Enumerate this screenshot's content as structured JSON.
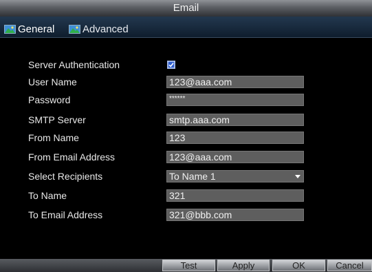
{
  "window": {
    "title": "Email"
  },
  "tabs": [
    {
      "label": "General",
      "active": true
    },
    {
      "label": "Advanced",
      "active": false
    }
  ],
  "form": {
    "server_authentication": {
      "label": "Server Authentication",
      "checked": true
    },
    "user_name": {
      "label": "User Name",
      "value": "123@aaa.com"
    },
    "password": {
      "label": "Password",
      "value": "******"
    },
    "smtp_server": {
      "label": "SMTP Server",
      "value": "smtp.aaa.com"
    },
    "from_name": {
      "label": "From Name",
      "value": "123"
    },
    "from_email_address": {
      "label": "From Email Address",
      "value": "123@aaa.com"
    },
    "select_recipients": {
      "label": "Select Recipients",
      "value": "To Name 1"
    },
    "to_name": {
      "label": "To Name",
      "value": "321"
    },
    "to_email_address": {
      "label": "To Email Address",
      "value": "321@bbb.com"
    }
  },
  "buttons": {
    "test": "Test",
    "apply": "Apply",
    "ok": "OK",
    "cancel": "Cancel"
  },
  "icons": {
    "tab_icon": "landscape-picture-icon",
    "checkbox_mark": "check-icon",
    "dropdown": "chevron-down-icon"
  },
  "colors": {
    "title_bar": "#5b5e63",
    "tab_bar": "#1a2b3e",
    "background": "#000000",
    "input_field": "#5e5e5e",
    "checkbox_accent": "#2f5fd0"
  }
}
